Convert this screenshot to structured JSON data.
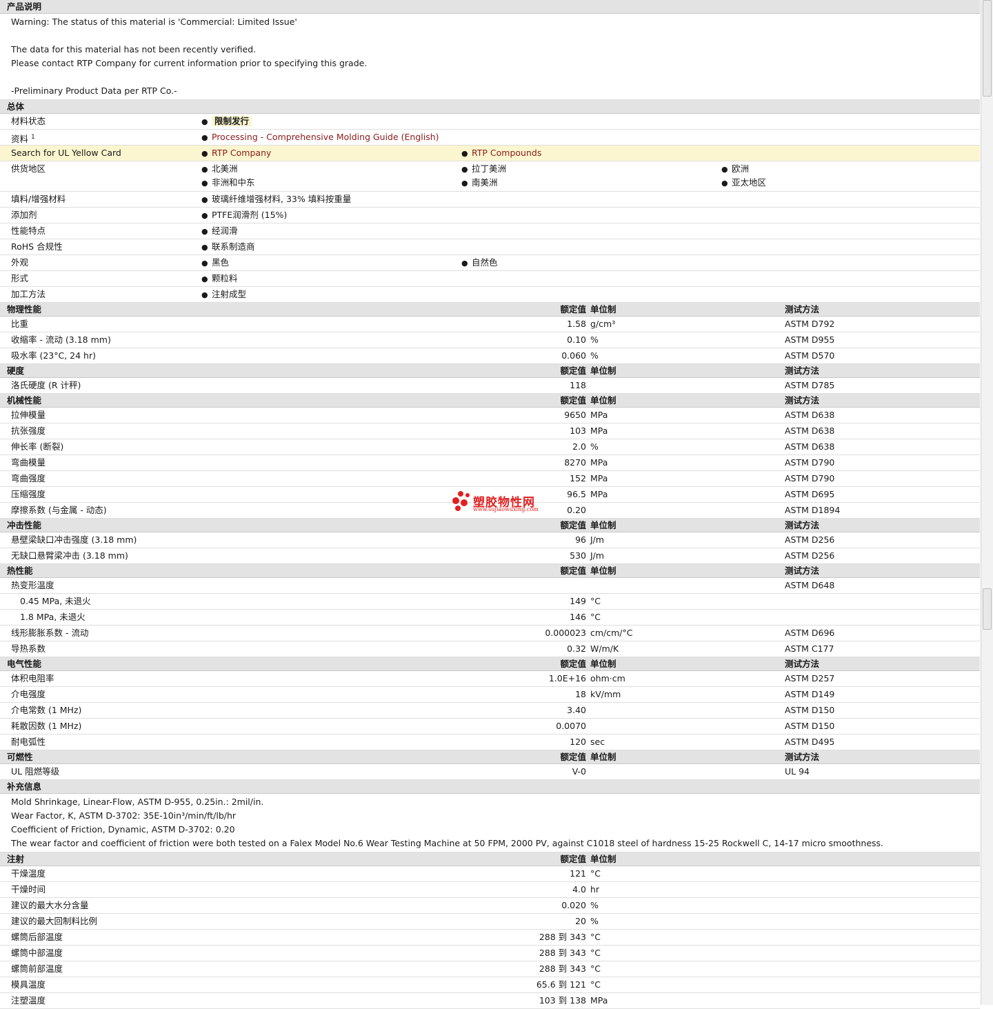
{
  "product_description": {
    "title": "产品说明",
    "lines": [
      "Warning: The status of this material is 'Commercial: Limited Issue'",
      "",
      "The data for this material has not been recently verified.",
      "Please contact RTP Company for current information prior to specifying this grade.",
      "",
      "-Preliminary Product Data per RTP Co.-"
    ]
  },
  "general": {
    "title": "总体",
    "status_label": "材料状态",
    "status_value": "限制发行",
    "docs_label": "资料",
    "docs_sup": "1",
    "docs_link": "Processing - Comprehensive Molding Guide (English)",
    "ul_label": "Search for UL Yellow Card",
    "ul_links": [
      "RTP Company",
      "RTP Compounds"
    ],
    "regions_label": "供货地区",
    "regions": [
      "北美洲",
      "拉丁美洲",
      "欧洲",
      "非洲和中东",
      "南美洲",
      "亚太地区"
    ],
    "rows": [
      {
        "label": "填料/增强材料",
        "values": [
          "玻璃纤维增强材料, 33% 填料按重量"
        ]
      },
      {
        "label": "添加剂",
        "values": [
          "PTFE润滑剂 (15%)"
        ]
      },
      {
        "label": "性能特点",
        "values": [
          "经润滑"
        ]
      },
      {
        "label": "RoHS 合规性",
        "values": [
          "联系制造商"
        ]
      },
      {
        "label": "外观",
        "values": [
          "黑色",
          "自然色"
        ]
      },
      {
        "label": "形式",
        "values": [
          "颗粒料"
        ]
      },
      {
        "label": "加工方法",
        "values": [
          "注射成型"
        ]
      }
    ]
  },
  "headers": {
    "value": "额定值",
    "unit": "单位制",
    "method": "测试方法"
  },
  "sections": [
    {
      "title": "物理性能",
      "rows": [
        {
          "label": "比重",
          "value": "1.58",
          "unit": "g/cm³",
          "method": "ASTM D792"
        },
        {
          "label": "收缩率 - 流动 (3.18 mm)",
          "value": "0.10",
          "unit": "%",
          "method": "ASTM D955"
        },
        {
          "label": "吸水率 (23°C, 24 hr)",
          "value": "0.060",
          "unit": "%",
          "method": "ASTM D570"
        }
      ]
    },
    {
      "title": "硬度",
      "rows": [
        {
          "label": "洛氏硬度 (R 计秤)",
          "value": "118",
          "unit": "",
          "method": "ASTM D785"
        }
      ]
    },
    {
      "title": "机械性能",
      "rows": [
        {
          "label": "拉伸模量",
          "value": "9650",
          "unit": "MPa",
          "method": "ASTM D638"
        },
        {
          "label": "抗张强度",
          "value": "103",
          "unit": "MPa",
          "method": "ASTM D638"
        },
        {
          "label": "伸长率 (断裂)",
          "value": "2.0",
          "unit": "%",
          "method": "ASTM D638"
        },
        {
          "label": "弯曲模量",
          "value": "8270",
          "unit": "MPa",
          "method": "ASTM D790"
        },
        {
          "label": "弯曲强度",
          "value": "152",
          "unit": "MPa",
          "method": "ASTM D790"
        },
        {
          "label": "压缩强度",
          "value": "96.5",
          "unit": "MPa",
          "method": "ASTM D695"
        },
        {
          "label": "摩擦系数 (与金属 - 动态)",
          "value": "0.20",
          "unit": "",
          "method": "ASTM D1894"
        }
      ]
    },
    {
      "title": "冲击性能",
      "rows": [
        {
          "label": "悬壁梁缺口冲击强度 (3.18 mm)",
          "value": "96",
          "unit": "J/m",
          "method": "ASTM D256"
        },
        {
          "label": "无缺口悬臂梁冲击 (3.18 mm)",
          "value": "530",
          "unit": "J/m",
          "method": "ASTM D256"
        }
      ]
    },
    {
      "title": "热性能",
      "rows": [
        {
          "label": "热变形温度",
          "value": "",
          "unit": "",
          "method": "ASTM D648"
        },
        {
          "label": "0.45 MPa, 未退火",
          "value": "149",
          "unit": "°C",
          "method": "",
          "sub": true
        },
        {
          "label": "1.8 MPa, 未退火",
          "value": "146",
          "unit": "°C",
          "method": "",
          "sub": true
        },
        {
          "label": "线形膨胀系数 - 流动",
          "value": "0.000023",
          "unit": "cm/cm/°C",
          "method": "ASTM D696"
        },
        {
          "label": "导热系数",
          "value": "0.32",
          "unit": "W/m/K",
          "method": "ASTM C177"
        }
      ]
    },
    {
      "title": "电气性能",
      "rows": [
        {
          "label": "体积电阻率",
          "value": "1.0E+16",
          "unit": "ohm·cm",
          "method": "ASTM D257"
        },
        {
          "label": "介电强度",
          "value": "18",
          "unit": "kV/mm",
          "method": "ASTM D149"
        },
        {
          "label": "介电常数 (1 MHz)",
          "value": "3.40",
          "unit": "",
          "method": "ASTM D150"
        },
        {
          "label": "耗散因数 (1 MHz)",
          "value": "0.0070",
          "unit": "",
          "method": "ASTM D150"
        },
        {
          "label": "耐电弧性",
          "value": "120",
          "unit": "sec",
          "method": "ASTM D495"
        }
      ]
    },
    {
      "title": "可燃性",
      "rows": [
        {
          "label": "UL 阻燃等级",
          "value": "V-0",
          "unit": "",
          "method": "UL 94"
        }
      ]
    }
  ],
  "supplementary": {
    "title": "补充信息",
    "lines": [
      "Mold Shrinkage, Linear-Flow, ASTM D-955, 0.25in.: 2mil/in.",
      "Wear Factor, K, ASTM D-3702: 35E-10in³/min/ft/lb/hr",
      "Coefficient of Friction, Dynamic, ASTM D-3702: 0.20",
      "The wear factor and coefficient of friction were both tested on a Falex Model No.6 Wear Testing Machine at 50 FPM, 2000 PV, against C1018 steel of hardness 15-25 Rockwell C, 14-17 micro smoothness."
    ]
  },
  "injection": {
    "title": "注射",
    "rows": [
      {
        "label": "干燥温度",
        "value": "121",
        "unit": "°C"
      },
      {
        "label": "干燥时间",
        "value": "4.0",
        "unit": "hr"
      },
      {
        "label": "建议的最大水分含量",
        "value": "0.020",
        "unit": "%"
      },
      {
        "label": "建议的最大回制料比例",
        "value": "20",
        "unit": "%"
      },
      {
        "label": "螺筒后部温度",
        "value": "288 到  343",
        "unit": "°C"
      },
      {
        "label": "螺筒中部温度",
        "value": "288 到  343",
        "unit": "°C"
      },
      {
        "label": "螺筒前部温度",
        "value": "288 到  343",
        "unit": "°C"
      },
      {
        "label": "模具温度",
        "value": "65.6 到  121",
        "unit": "°C"
      },
      {
        "label": "注塑温度",
        "value": "103 到  138",
        "unit": "MPa"
      }
    ]
  },
  "watermark": {
    "name": "塑胶物性网",
    "url": "www.sujiaowuxing.com"
  }
}
